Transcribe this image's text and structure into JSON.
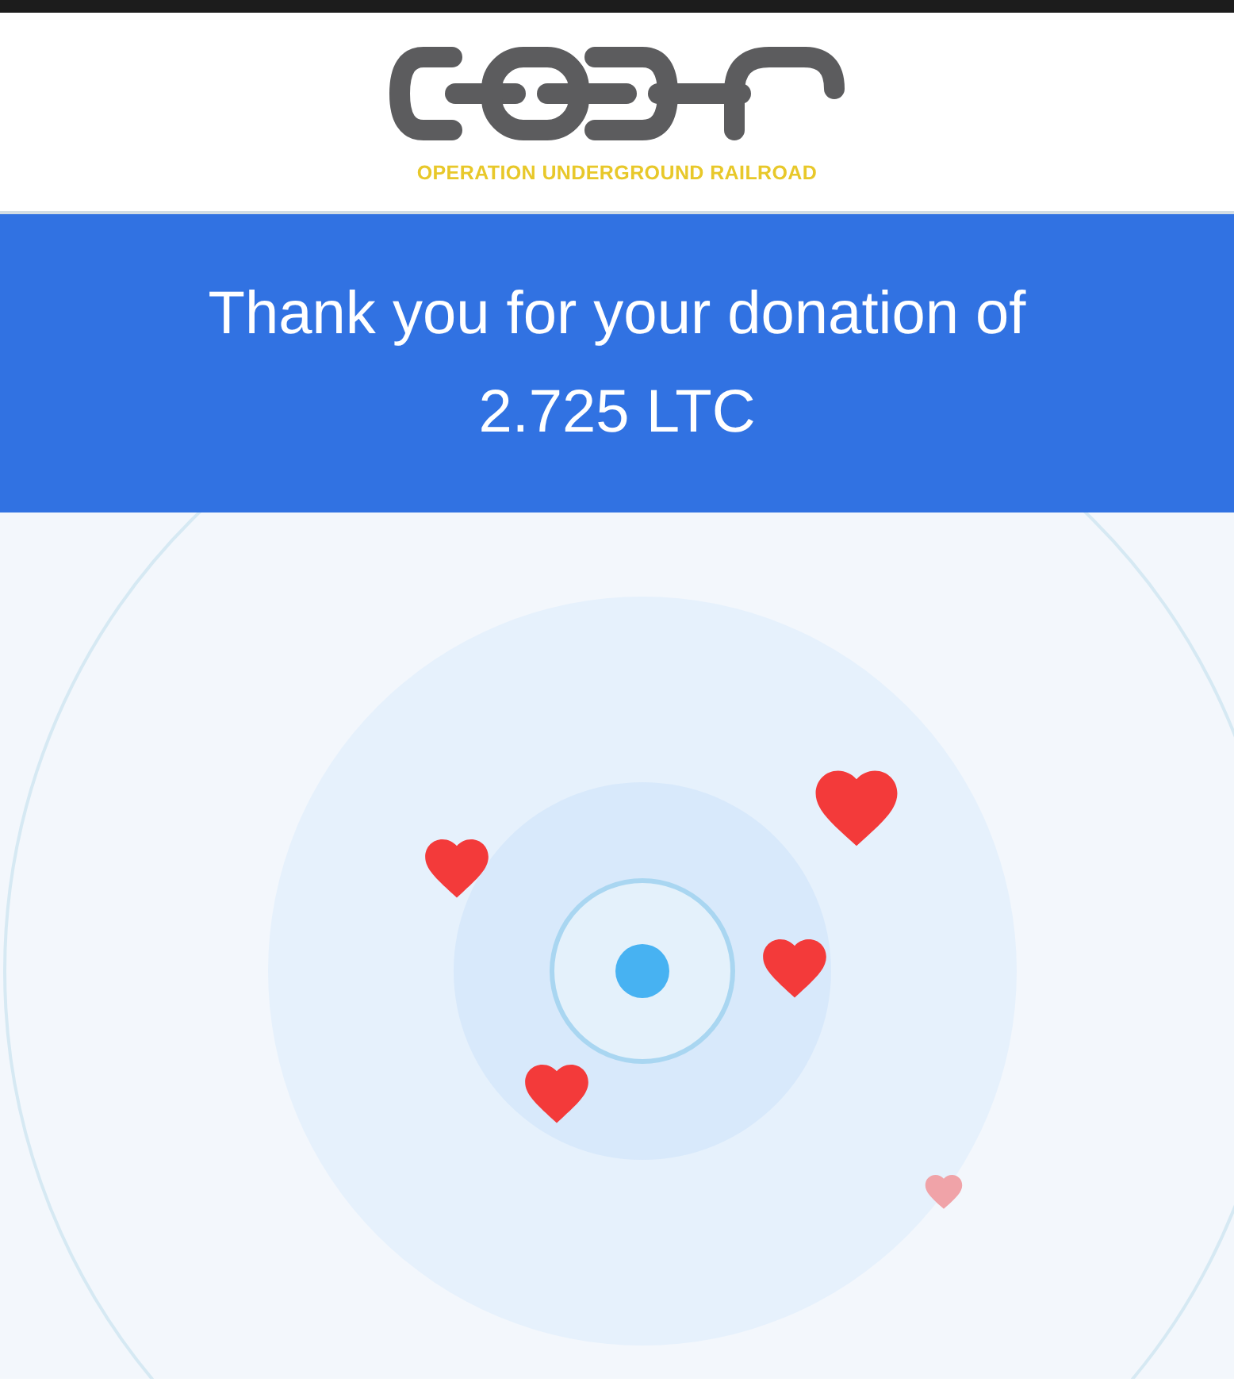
{
  "header": {
    "caption": "OPERATION UNDERGROUND RAILROAD"
  },
  "banner": {
    "message": "Thank you for your donation of 2.725 LTC"
  }
}
